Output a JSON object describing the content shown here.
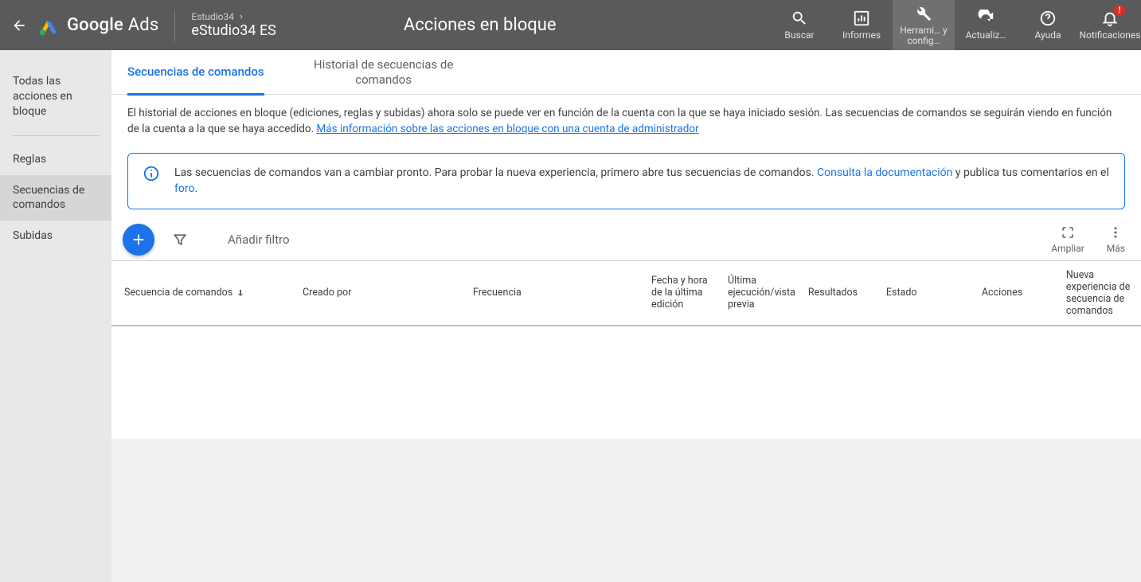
{
  "header": {
    "brand_strong": "Google",
    "brand_light": "Ads",
    "account_parent": "Estudio34",
    "account_name": "eStudio34 ES",
    "page_title": "Acciones en bloque",
    "actions": {
      "search": "Buscar",
      "reports": "Informes",
      "tools": "Herrami… y config…",
      "refresh": "Actualiz…",
      "help": "Ayuda",
      "notifications": "Notificaciones"
    },
    "badge": "!"
  },
  "sidebar": {
    "items": [
      "Todas las acciones en bloque",
      "Reglas",
      "Secuencias de comandos",
      "Subidas"
    ],
    "active_index": 2
  },
  "tabs": [
    {
      "label": "Secuencias de comandos",
      "active": true
    },
    {
      "label": "Historial de secuencias de comandos",
      "active": false
    }
  ],
  "notice": {
    "text": "El historial de acciones en bloque (ediciones, reglas y subidas) ahora solo se puede ver en función de la cuenta con la que se haya iniciado sesión. Las secuencias de comandos se seguirán viendo en función de la cuenta a la que se haya accedido. ",
    "link": "Más información sobre las acciones en bloque con una cuenta de administrador"
  },
  "banner": {
    "t1": "Las secuencias de comandos van a cambiar pronto. Para probar la nueva experiencia, primero abre tus secuencias de comandos. ",
    "link1": "Consulta la documentación",
    "t2": " y publica tus comentarios en el ",
    "link2": "foro",
    "t3": "."
  },
  "toolbar": {
    "add_filter": "Añadir filtro",
    "expand": "Ampliar",
    "more": "Más"
  },
  "columns": [
    "Secuencia de comandos",
    "Creado por",
    "Frecuencia",
    "Fecha y hora de la última edición",
    "Última ejecución/vista previa",
    "Resultados",
    "Estado",
    "Acciones",
    "Nueva experiencia de secuencia de comandos"
  ]
}
